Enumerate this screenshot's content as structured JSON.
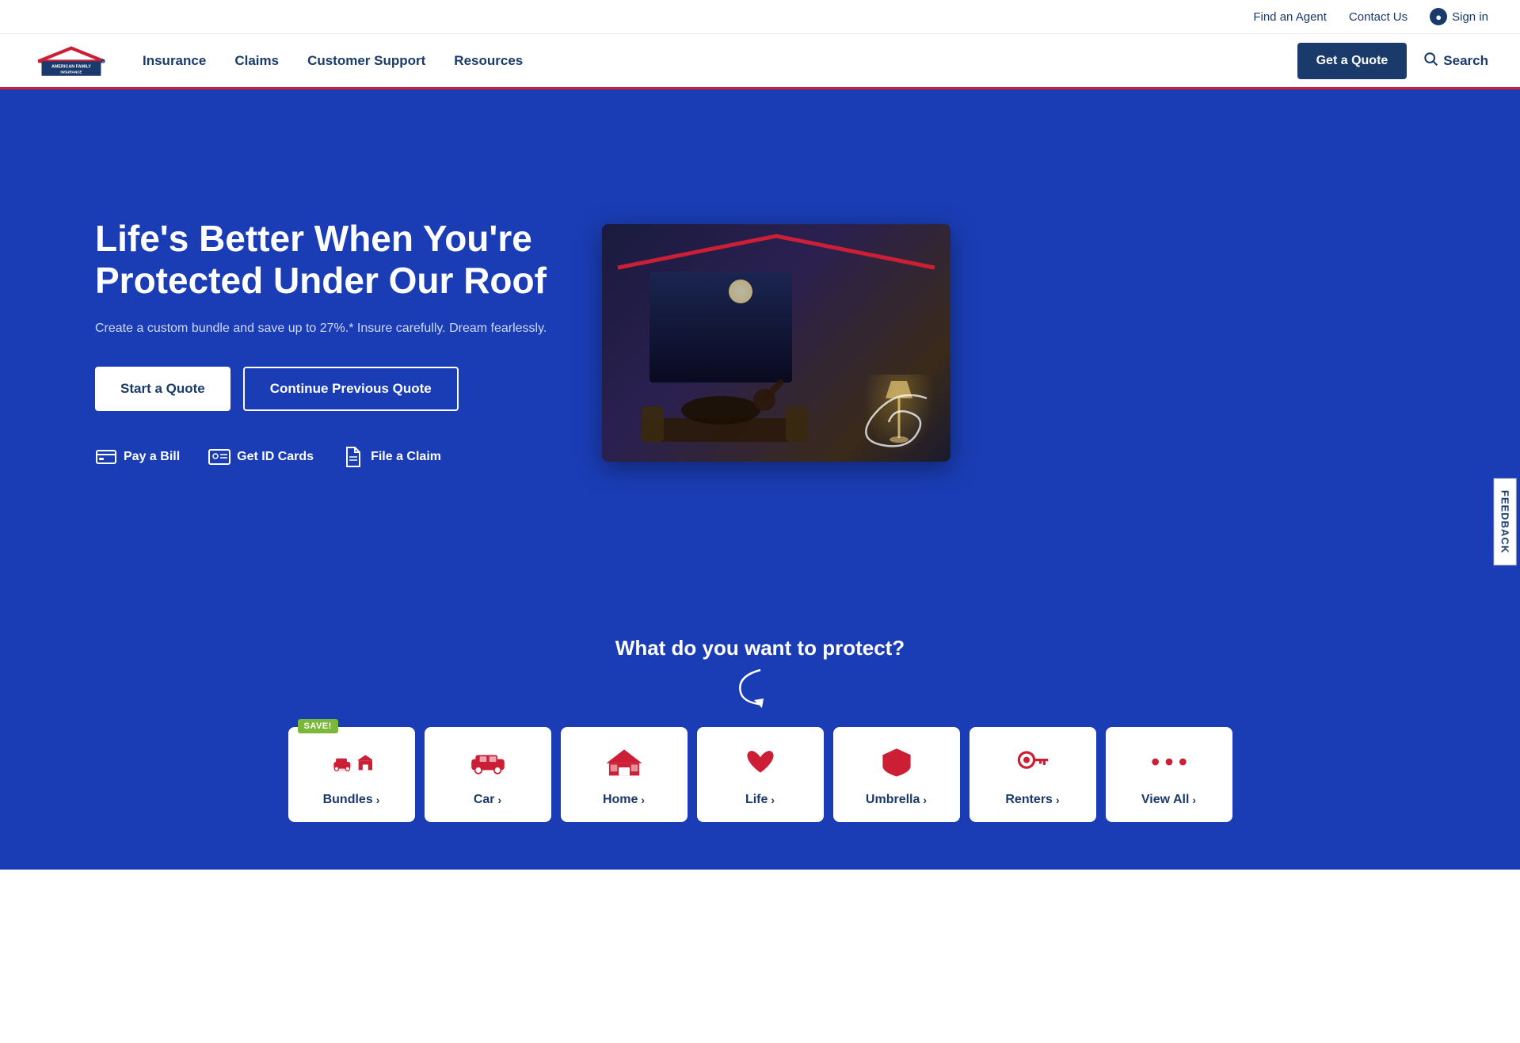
{
  "topbar": {
    "find_agent": "Find an Agent",
    "contact_us": "Contact Us",
    "sign_in": "Sign in"
  },
  "nav": {
    "insurance": "Insurance",
    "claims": "Claims",
    "customer_support": "Customer Support",
    "resources": "Resources",
    "get_quote": "Get a Quote",
    "search": "Search"
  },
  "hero": {
    "title": "Life's Better When You're Protected Under Our Roof",
    "subtitle": "Create a custom bundle and save up to 27%.* Insure carefully. Dream fearlessly.",
    "btn_start": "Start a Quote",
    "btn_continue": "Continue Previous Quote",
    "quick_links": [
      {
        "label": "Pay a Bill",
        "icon": "credit-card-icon"
      },
      {
        "label": "Get ID Cards",
        "icon": "id-card-icon"
      },
      {
        "label": "File a Claim",
        "icon": "file-icon"
      }
    ]
  },
  "protect": {
    "title": "What do you want to protect?",
    "products": [
      {
        "label": "Bundles",
        "icon": "bundles",
        "save_badge": "SAVE!"
      },
      {
        "label": "Car",
        "icon": "car",
        "save_badge": null
      },
      {
        "label": "Home",
        "icon": "home",
        "save_badge": null
      },
      {
        "label": "Life",
        "icon": "life",
        "save_badge": null
      },
      {
        "label": "Umbrella",
        "icon": "umbrella",
        "save_badge": null
      },
      {
        "label": "Renters",
        "icon": "renters",
        "save_badge": null
      },
      {
        "label": "View All",
        "icon": "more",
        "save_badge": null
      }
    ]
  },
  "feedback": {
    "label": "FEEDBACK"
  },
  "colors": {
    "brand_blue": "#1a3db5",
    "brand_dark_blue": "#1a3a6b",
    "brand_red": "#cc1f36",
    "save_green": "#7bb83a"
  }
}
